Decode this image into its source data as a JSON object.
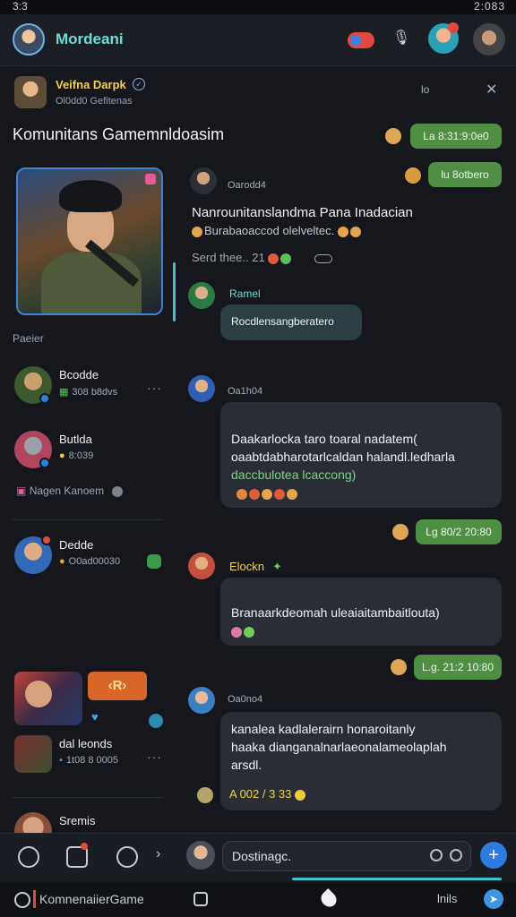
{
  "status_bar": {
    "time": "3:3",
    "right": "2:083"
  },
  "header": {
    "title": "Mordeani",
    "mic_icon": "🎙"
  },
  "chat_head": {
    "name": "Veifna Darpk",
    "subtitle": "Ol0dd0 Gefitenas",
    "more_label": "lo",
    "close_label": "✕"
  },
  "channel_title": "Komunitans Gamemnldoasim",
  "left": {
    "label": "Paeier",
    "contacts": [
      {
        "name": "Bcodde",
        "meta": "308 b8dvs"
      },
      {
        "name": "Butlda",
        "meta": "8:039"
      },
      {
        "name": "Dedde",
        "meta": "O0ad00030"
      },
      {
        "name": "dal leonds",
        "meta": "1t08 8 0005"
      },
      {
        "name": "Sremis",
        "meta": ""
      }
    ],
    "extra_line": "Nagen Kanoem",
    "promo_label": "R"
  },
  "messages": [
    {
      "sender": "Oarodd4",
      "title": "Nanrounitanslandma Pana Inadacian",
      "sub": "Burabaoaccod olelveltec.",
      "meta": "Serd thee..  21"
    },
    {
      "sender": "Ramel",
      "bubble": "Rocdlensangberatero"
    },
    {
      "sender": "Oa1h04",
      "lines": [
        "Daakarlocka taro toaral nadatem(",
        "oaabtdabharotarlcaldan halandl.ledharla",
        "daccbulotea lcaccong)"
      ]
    },
    {
      "sender": "Elockn",
      "lines": [
        "Branaarkdeomah uleaiaitambaitlouta)"
      ]
    },
    {
      "sender": "Oa0no4",
      "lines": [
        "kanalea kadlalerairn honaroitanly",
        "haaka dianganalnarlaeonalameolaplah",
        "arsdl."
      ],
      "meta": "A 002 / 3 33"
    }
  ],
  "pills": [
    "La 8:31:9:0e0",
    "lu 8otbero",
    "Lg 80/2 20:80",
    "L.g. 21:2 10:80"
  ],
  "compose": {
    "placeholder": "Dostinagc."
  },
  "system_bar": {
    "brand": "KomnenaiierGame",
    "right_label": "lnils"
  },
  "colors": {
    "accent": "#6fdcd2",
    "pill": "#4f8f44",
    "send": "#2f7be0"
  }
}
